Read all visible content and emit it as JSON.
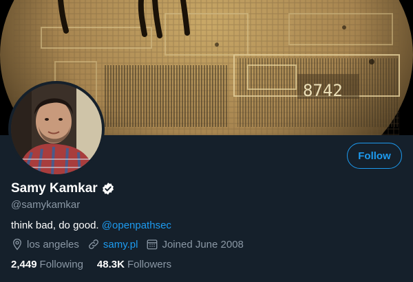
{
  "profile": {
    "name": "Samy Kamkar",
    "handle": "@samykamkar",
    "bio_text": "think bad, do good.",
    "bio_mention": "@openpathsec",
    "location": "los angeles",
    "website": "samy.pl",
    "joined": "Joined June 2008",
    "following_count": "2,449",
    "following_label": "Following",
    "followers_count": "48.3K",
    "followers_label": "Followers"
  },
  "actions": {
    "follow_label": "Follow"
  },
  "banner": {
    "chip_marking": "8742"
  },
  "icons": {
    "verified": "verified-badge-icon",
    "location": "location-pin-icon",
    "website": "link-icon",
    "joined": "calendar-icon"
  },
  "colors": {
    "background": "#15202b",
    "accent": "#1d9bf0",
    "secondary_text": "#8b98a5",
    "primary_text": "#ffffff"
  }
}
